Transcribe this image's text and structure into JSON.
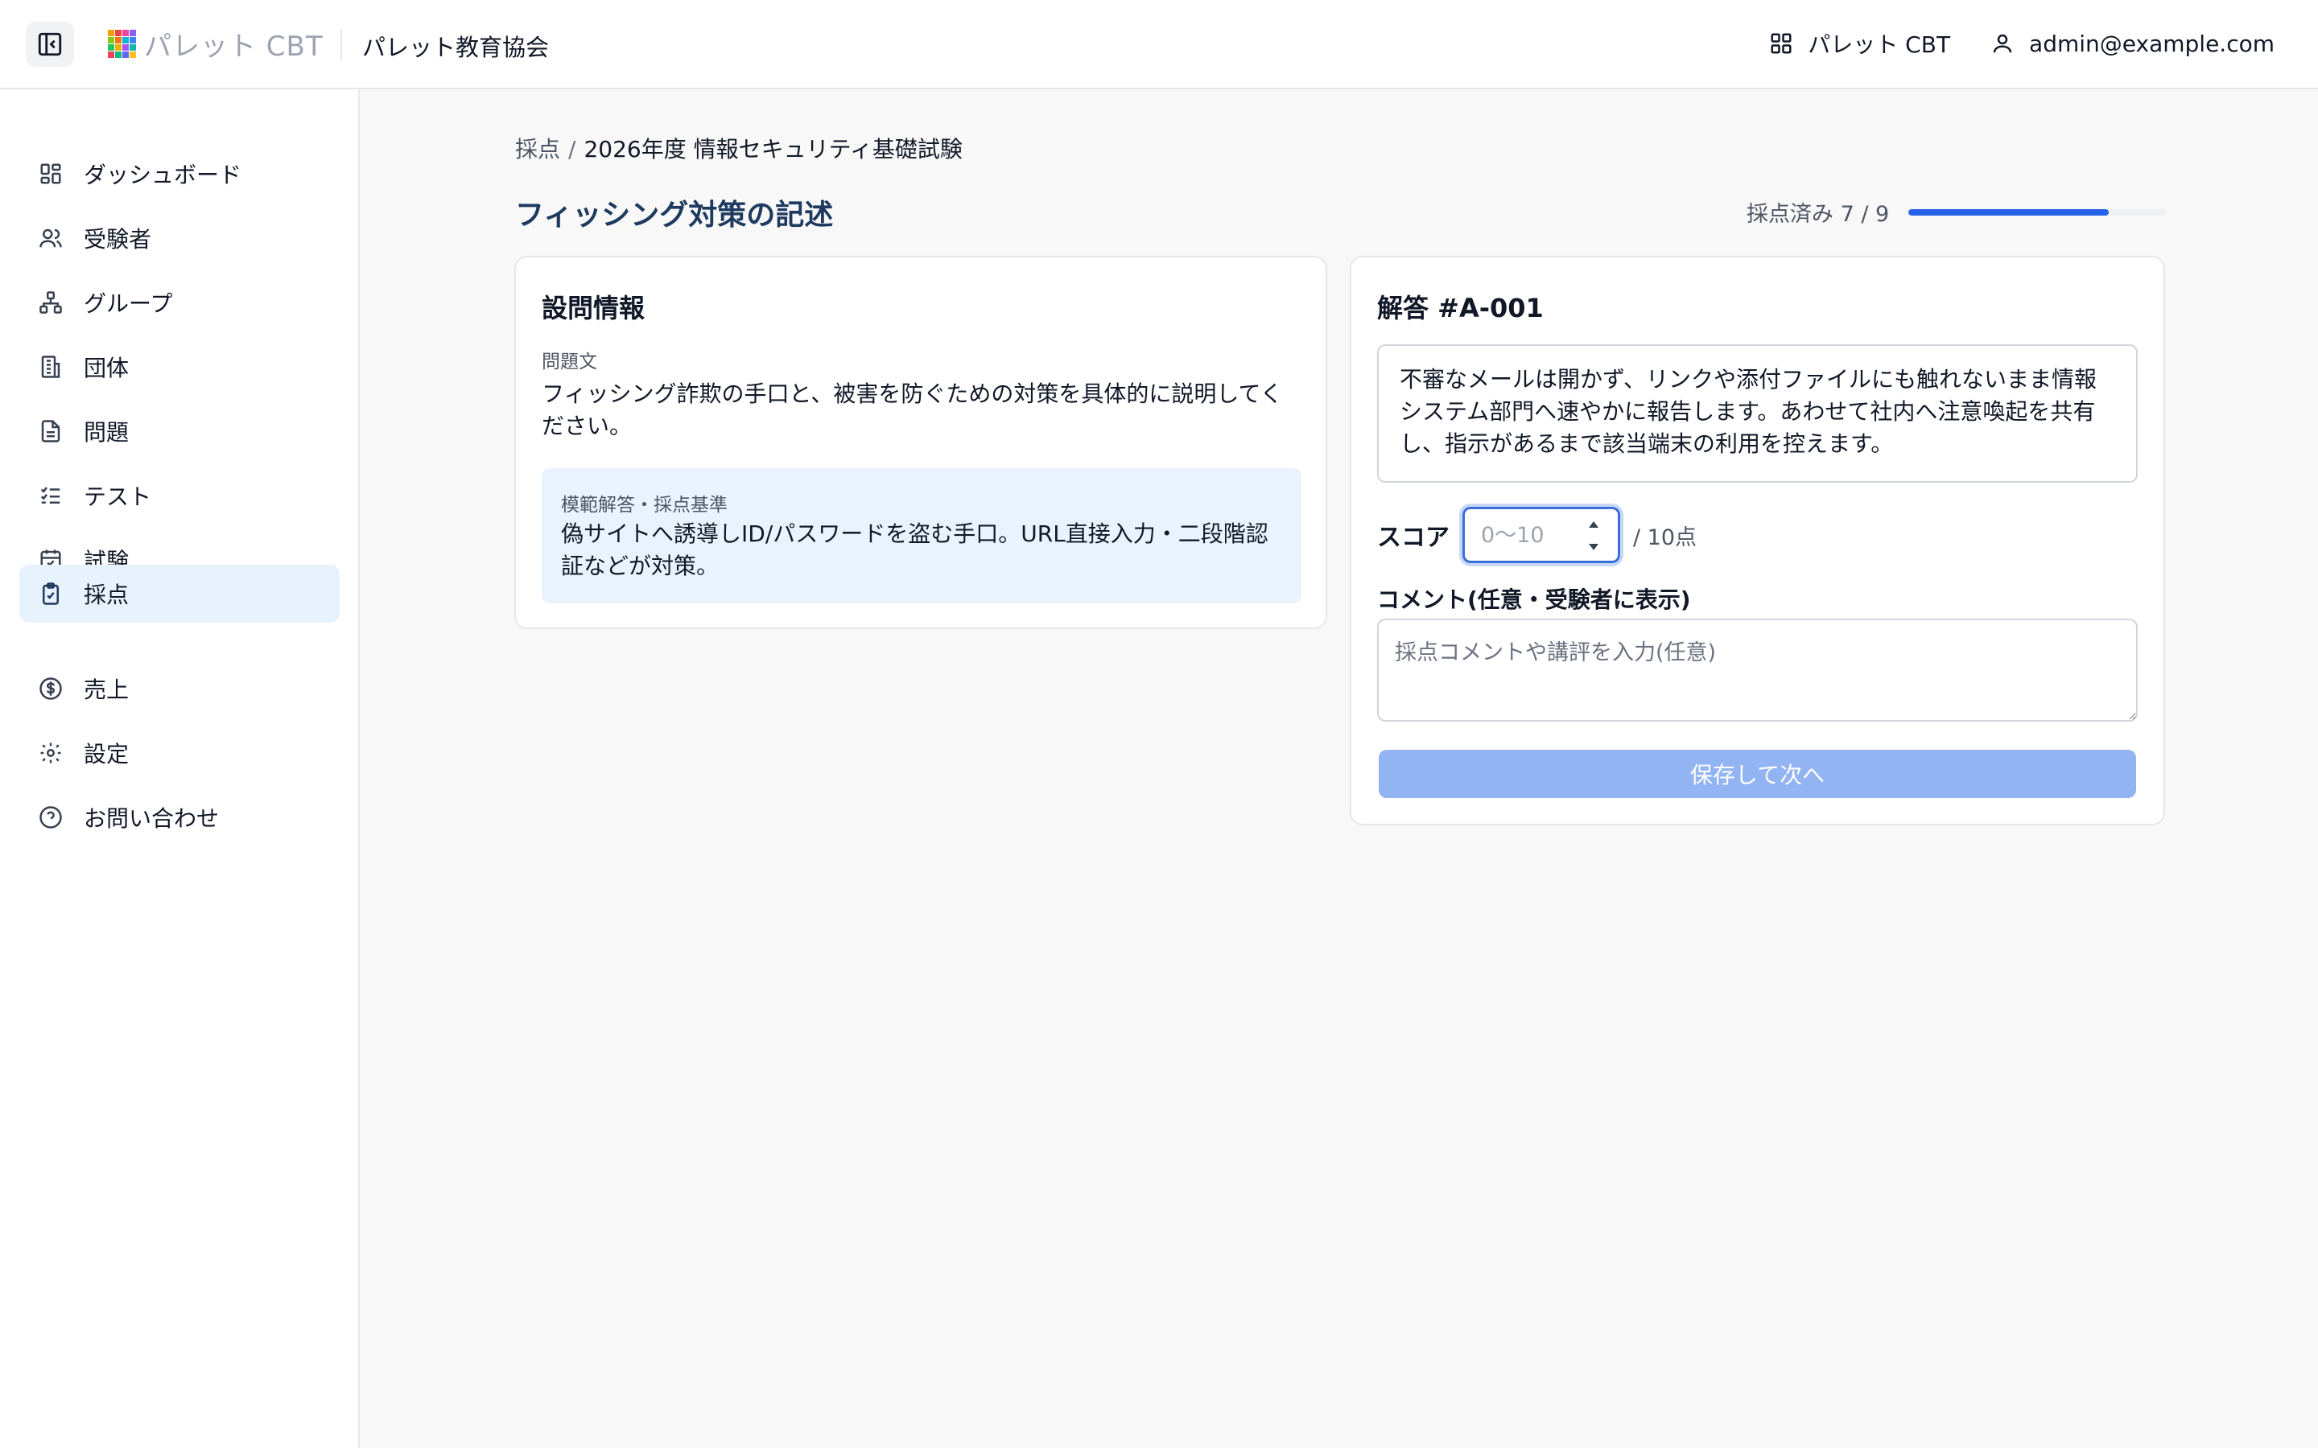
{
  "header": {
    "logo_text": "パレット CBT",
    "org_name": "パレット教育協会",
    "app_link": "パレット CBT",
    "user_email": "admin@example.com"
  },
  "sidebar": {
    "items": [
      {
        "label": "ダッシュボード",
        "icon": "dashboard-icon"
      },
      {
        "label": "受験者",
        "icon": "users-icon"
      },
      {
        "label": "グループ",
        "icon": "group-icon"
      },
      {
        "label": "団体",
        "icon": "building-icon"
      },
      {
        "label": "問題",
        "icon": "document-icon"
      },
      {
        "label": "テスト",
        "icon": "checklist-icon"
      },
      {
        "label": "試験",
        "icon": "calendar-icon"
      },
      {
        "label": "採点",
        "icon": "clipboard-check-icon",
        "active": true
      },
      {
        "label": "売上",
        "icon": "dollar-icon"
      },
      {
        "label": "設定",
        "icon": "gear-icon"
      },
      {
        "label": "お問い合わせ",
        "icon": "help-icon"
      }
    ]
  },
  "breadcrumb": {
    "root": "採点",
    "separator": "/",
    "current": "2026年度 情報セキュリティ基礎試験"
  },
  "page": {
    "title": "フィッシング対策の記述",
    "progress_label": "採点済み 7 / 9",
    "progress_done": 7,
    "progress_total": 9
  },
  "question_card": {
    "title": "設問情報",
    "question_label": "問題文",
    "question_text": "フィッシング詐欺の手口と、被害を防ぐための対策を具体的に説明してください。",
    "model_label": "模範解答・採点基準",
    "model_text": "偽サイトへ誘導しID/パスワードを盗む手口。URL直接入力・二段階認証などが対策。"
  },
  "answer_card": {
    "title": "解答 #A-001",
    "answer_text": "不審なメールは開かず、リンクや添付ファイルにも触れないまま情報システム部門へ速やかに報告します。あわせて社内へ注意喚起を共有し、指示があるまで該当端末の利用を控えます。",
    "score_label": "スコア",
    "score_placeholder": "0〜10",
    "score_max": "/ 10点",
    "comment_label": "コメント(任意・受験者に表示)",
    "comment_placeholder": "採点コメントや講評を入力(任意)",
    "save_button": "保存して次へ"
  },
  "colors": {
    "accent": "#2563eb",
    "title": "#1e3a5f",
    "active_nav_bg": "#e8f2fd",
    "save_button_disabled": "#93b4f3"
  }
}
